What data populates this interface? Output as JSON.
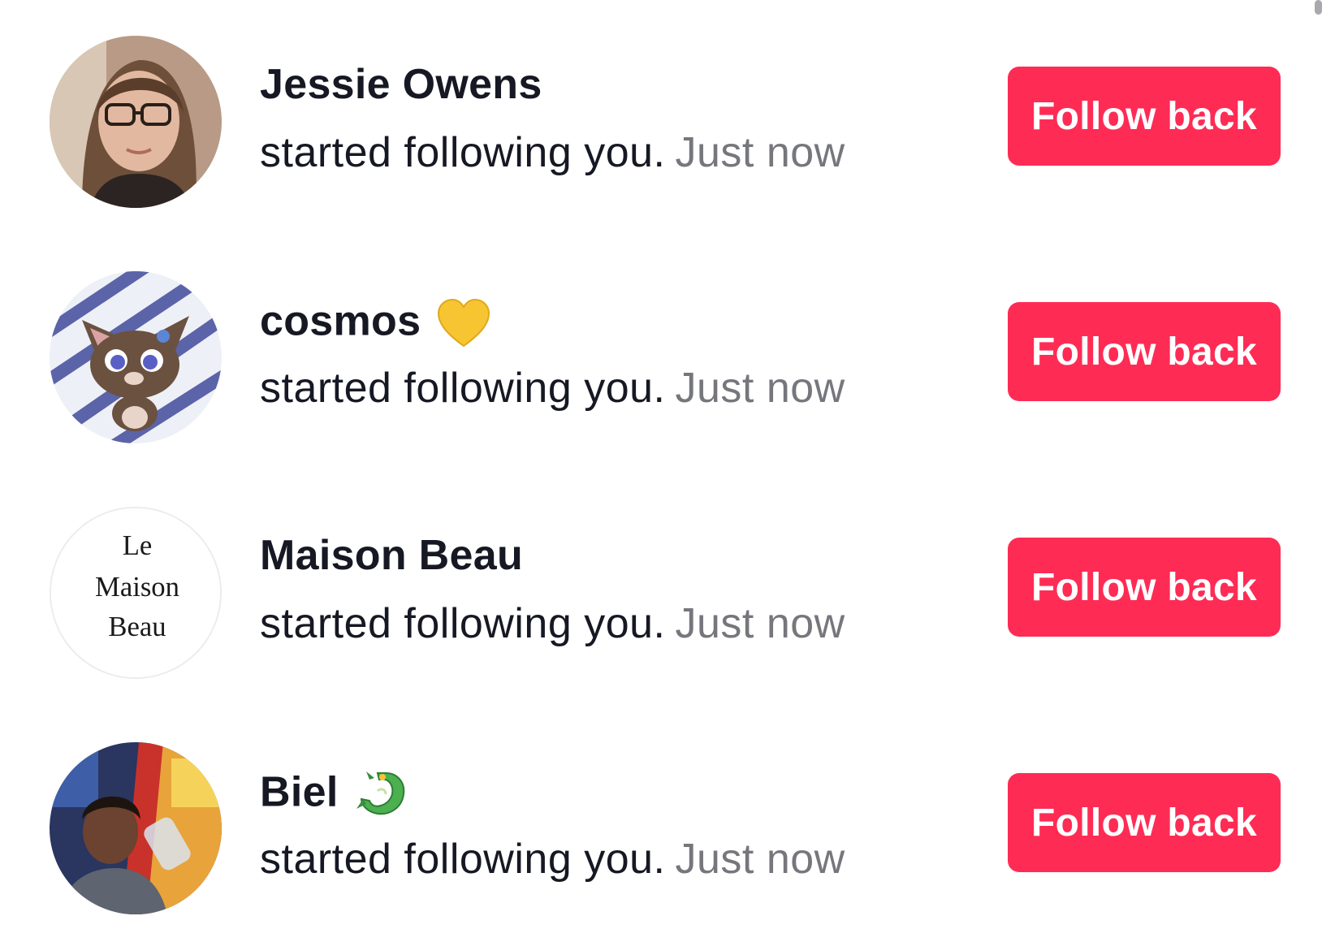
{
  "notifications": [
    {
      "name": "Jessie Owens",
      "name_emoji_icon": "",
      "action": "started following you.",
      "time": "Just now",
      "button_label": "Follow back",
      "avatar_icon": "avatar-photo-woman-glasses"
    },
    {
      "name": "cosmos",
      "name_emoji_icon": "yellow-heart-icon",
      "action": "started following you.",
      "time": "Just now",
      "button_label": "Follow back",
      "avatar_icon": "avatar-cartoon-cat"
    },
    {
      "name": "Maison Beau",
      "name_emoji_icon": "",
      "action": "started following you.",
      "time": "Just now",
      "button_label": "Follow back",
      "avatar_icon": "avatar-logo-text",
      "avatar_logo_text": "Le Maison Beau"
    },
    {
      "name": "Biel",
      "name_emoji_icon": "dragon-icon",
      "action": "started following you.",
      "time": "Just now",
      "button_label": "Follow back",
      "avatar_icon": "avatar-photo-man"
    }
  ],
  "colors": {
    "accent": "#fe2c55",
    "text_primary": "#161823",
    "text_secondary": "#76777d",
    "background": "#ffffff"
  }
}
